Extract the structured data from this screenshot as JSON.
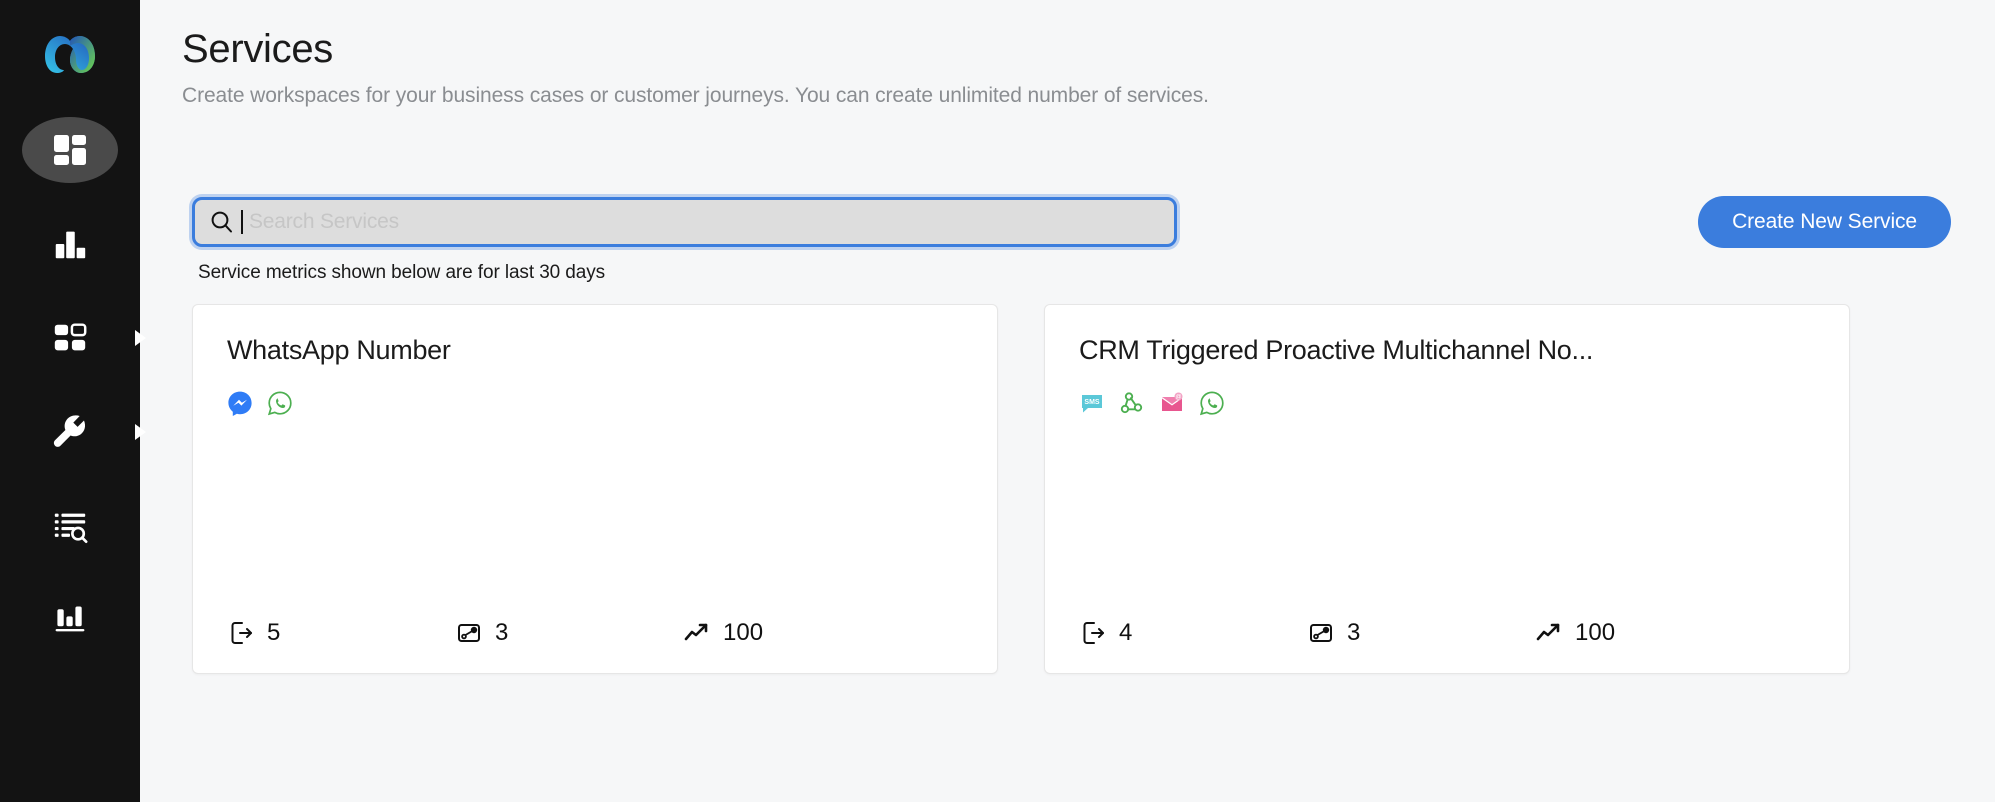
{
  "sidebar": {
    "logo_name": "webex-logo",
    "items": [
      {
        "id": "dashboard",
        "icon": "dashboard-grid-icon",
        "active": true,
        "has_caret": false
      },
      {
        "id": "analytics",
        "icon": "bar-chart-icon",
        "active": false,
        "has_caret": false
      },
      {
        "id": "apps",
        "icon": "apps-grid-icon",
        "active": false,
        "has_caret": true
      },
      {
        "id": "tools",
        "icon": "wrench-icon",
        "active": false,
        "has_caret": true
      },
      {
        "id": "logs",
        "icon": "list-search-icon",
        "active": false,
        "has_caret": false
      },
      {
        "id": "reports",
        "icon": "reports-chart-icon",
        "active": false,
        "has_caret": false
      }
    ]
  },
  "header": {
    "title": "Services",
    "subtitle": "Create workspaces for your business cases or customer journeys. You can create unlimited number of services."
  },
  "toolbar": {
    "search_placeholder": "Search Services",
    "search_value": "",
    "search_icon": "search-icon",
    "create_button_label": "Create New Service",
    "accent_color": "#3b7ddd"
  },
  "metrics_note": "Service metrics shown below are for last 30 days",
  "cards": [
    {
      "title": "WhatsApp Number",
      "channels": [
        "messenger-icon",
        "whatsapp-icon"
      ],
      "metrics": [
        {
          "icon": "exit-logout-icon",
          "value": "5"
        },
        {
          "icon": "flow-node-icon",
          "value": "3"
        },
        {
          "icon": "trending-up-icon",
          "value": "100"
        }
      ]
    },
    {
      "title": "CRM Triggered Proactive Multichannel No...",
      "channels": [
        "sms-icon",
        "webhook-icon",
        "email-icon",
        "whatsapp-icon"
      ],
      "metrics": [
        {
          "icon": "exit-logout-icon",
          "value": "4"
        },
        {
          "icon": "flow-node-icon",
          "value": "3"
        },
        {
          "icon": "trending-up-icon",
          "value": "100"
        }
      ]
    }
  ],
  "colors": {
    "sidebar_bg": "#131313",
    "page_bg": "#f6f7f8",
    "accent": "#3b7ddd",
    "whatsapp_green": "#4caf50",
    "messenger_blue": "#2f7cf6",
    "sms_teal": "#5bc8d8",
    "email_pink": "#e8568f"
  }
}
